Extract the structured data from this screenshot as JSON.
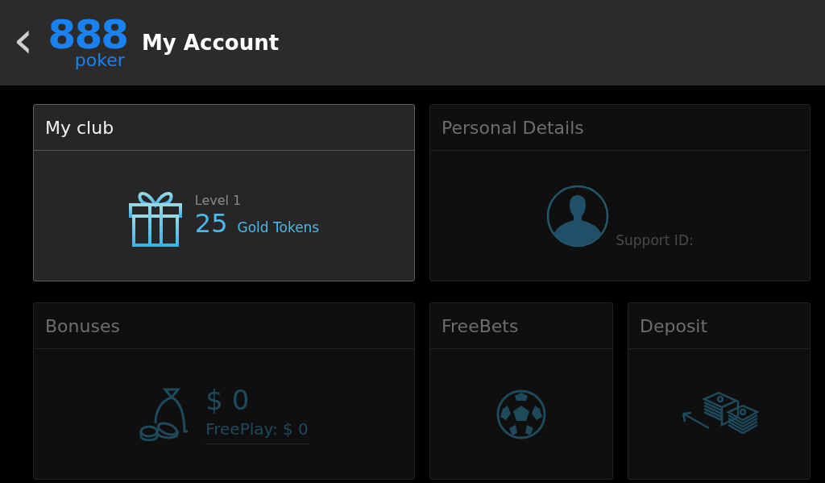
{
  "header": {
    "back": "‹",
    "logo": {
      "digits": "888",
      "word": "poker"
    },
    "title": "My Account"
  },
  "cards": [
    {
      "kind": "club",
      "title": "My club",
      "active": true,
      "level": "Level 1",
      "tokens": "25",
      "tokens_label": "Gold Tokens"
    },
    {
      "kind": "personal",
      "title": "Personal Details",
      "active": false,
      "support": "Support ID:"
    },
    {
      "kind": "bonuses",
      "title": "Bonuses",
      "active": false,
      "amount": "$ 0",
      "freeplay": "FreePlay: $ 0"
    },
    {
      "kind": "freebets",
      "title": "FreeBets",
      "active": false
    },
    {
      "kind": "deposit",
      "title": "Deposit",
      "active": false
    }
  ]
}
